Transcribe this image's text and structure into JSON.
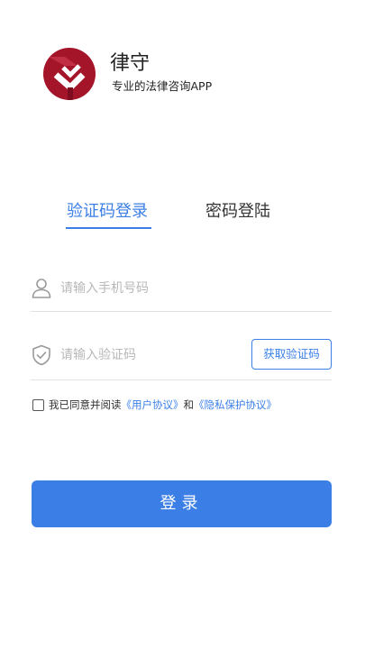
{
  "header": {
    "app_name": "律守",
    "slogan": "专业的法律咨询APP",
    "logo_icon": "lvshou-logo-icon",
    "logo_colors": {
      "circle": "#a5152a",
      "mark": "#ffffff"
    }
  },
  "tabs": [
    {
      "label": "验证码登录",
      "active": true
    },
    {
      "label": "密码登陆",
      "active": false
    }
  ],
  "form": {
    "phone": {
      "icon": "user-icon",
      "placeholder": "请输入手机号码",
      "value": ""
    },
    "code": {
      "icon": "shield-check-icon",
      "placeholder": "请输入验证码",
      "value": ""
    },
    "get_code_label": "获取验证码"
  },
  "agreement": {
    "checked": false,
    "prefix": "我已同意并阅读",
    "user_agreement": "《用户协议》",
    "joiner": "和",
    "privacy_policy": "《隐私保护协议》"
  },
  "login_label": "登录",
  "colors": {
    "accent": "#3b7fe6",
    "text": "#333333",
    "placeholder": "#b8b8b8",
    "divider": "#e3e3e3"
  }
}
